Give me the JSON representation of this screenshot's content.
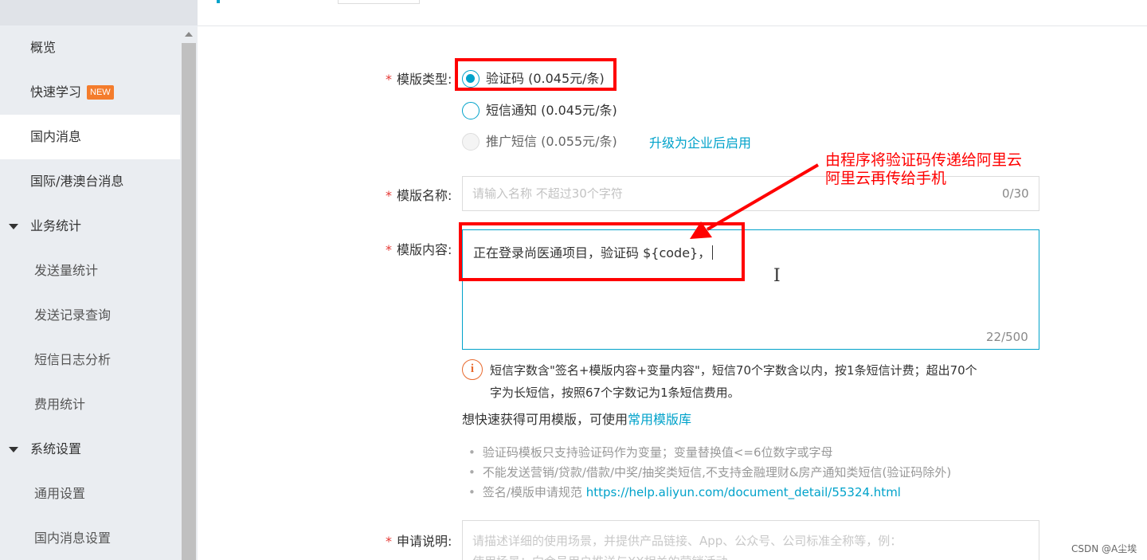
{
  "sidebar": {
    "items": [
      {
        "label": "概览"
      },
      {
        "label": "快速学习",
        "badge": "NEW"
      },
      {
        "label": "国内消息",
        "active": true
      },
      {
        "label": "国际/港澳台消息"
      },
      {
        "label": "业务统计",
        "group": true
      },
      {
        "label": "发送量统计"
      },
      {
        "label": "发送记录查询"
      },
      {
        "label": "短信日志分析"
      },
      {
        "label": "费用统计"
      },
      {
        "label": "系统设置",
        "group": true
      },
      {
        "label": "通用设置"
      },
      {
        "label": "国内消息设置"
      }
    ]
  },
  "form": {
    "template_type": {
      "label": "模版类型:",
      "options": [
        {
          "label": "验证码 (0.045元/条)",
          "selected": true
        },
        {
          "label": "短信通知 (0.045元/条)",
          "selected": false
        },
        {
          "label": "推广短信 (0.055元/条)",
          "disabled": true
        }
      ],
      "upgrade_link": "升级为企业后启用"
    },
    "template_name": {
      "label": "模版名称:",
      "placeholder": "请输入名称 不超过30个字符",
      "counter": "0/30"
    },
    "template_content": {
      "label": "模版内容:",
      "value": "正在登录尚医通项目，验证码 ${code}，",
      "counter": "22/500"
    },
    "info": {
      "icon": "i",
      "line1": "短信字数含\"签名+模版内容+变量内容\"，短信70个字数含以内，按1条短信计费；超出70个",
      "line2": "字为长短信，按照67个字数记为1条短信费用。"
    },
    "quick": {
      "text": "想快速获得可用模版，可使用",
      "link": "常用模版库"
    },
    "tips": [
      {
        "text": "验证码模板只支持验证码作为变量；变量替换值<=6位数字或字母"
      },
      {
        "text": "不能发送营销/贷款/借款/中奖/抽奖类短信,不支持金融理财&房产通知类短信(验证码除外)"
      },
      {
        "text": "签名/模版申请规范 ",
        "link": "https://help.aliyun.com/document_detail/55324.html"
      }
    ],
    "apply": {
      "label": "申请说明:",
      "placeholder_line1": "请描述详细的使用场景，并提供产品链接、App、公众号、公司标准全称等，例：",
      "placeholder_line2": "使用场景：向会员用户推送与XX相关的营销活动"
    }
  },
  "annotation": {
    "line1": "由程序将验证码传递给阿里云",
    "line2": "阿里云再传给手机"
  },
  "watermark": "CSDN @A尘埃",
  "colors": {
    "accent": "#00a2ca",
    "required": "#e53935",
    "annotation": "#ff0000",
    "warning": "#e86a2e"
  }
}
